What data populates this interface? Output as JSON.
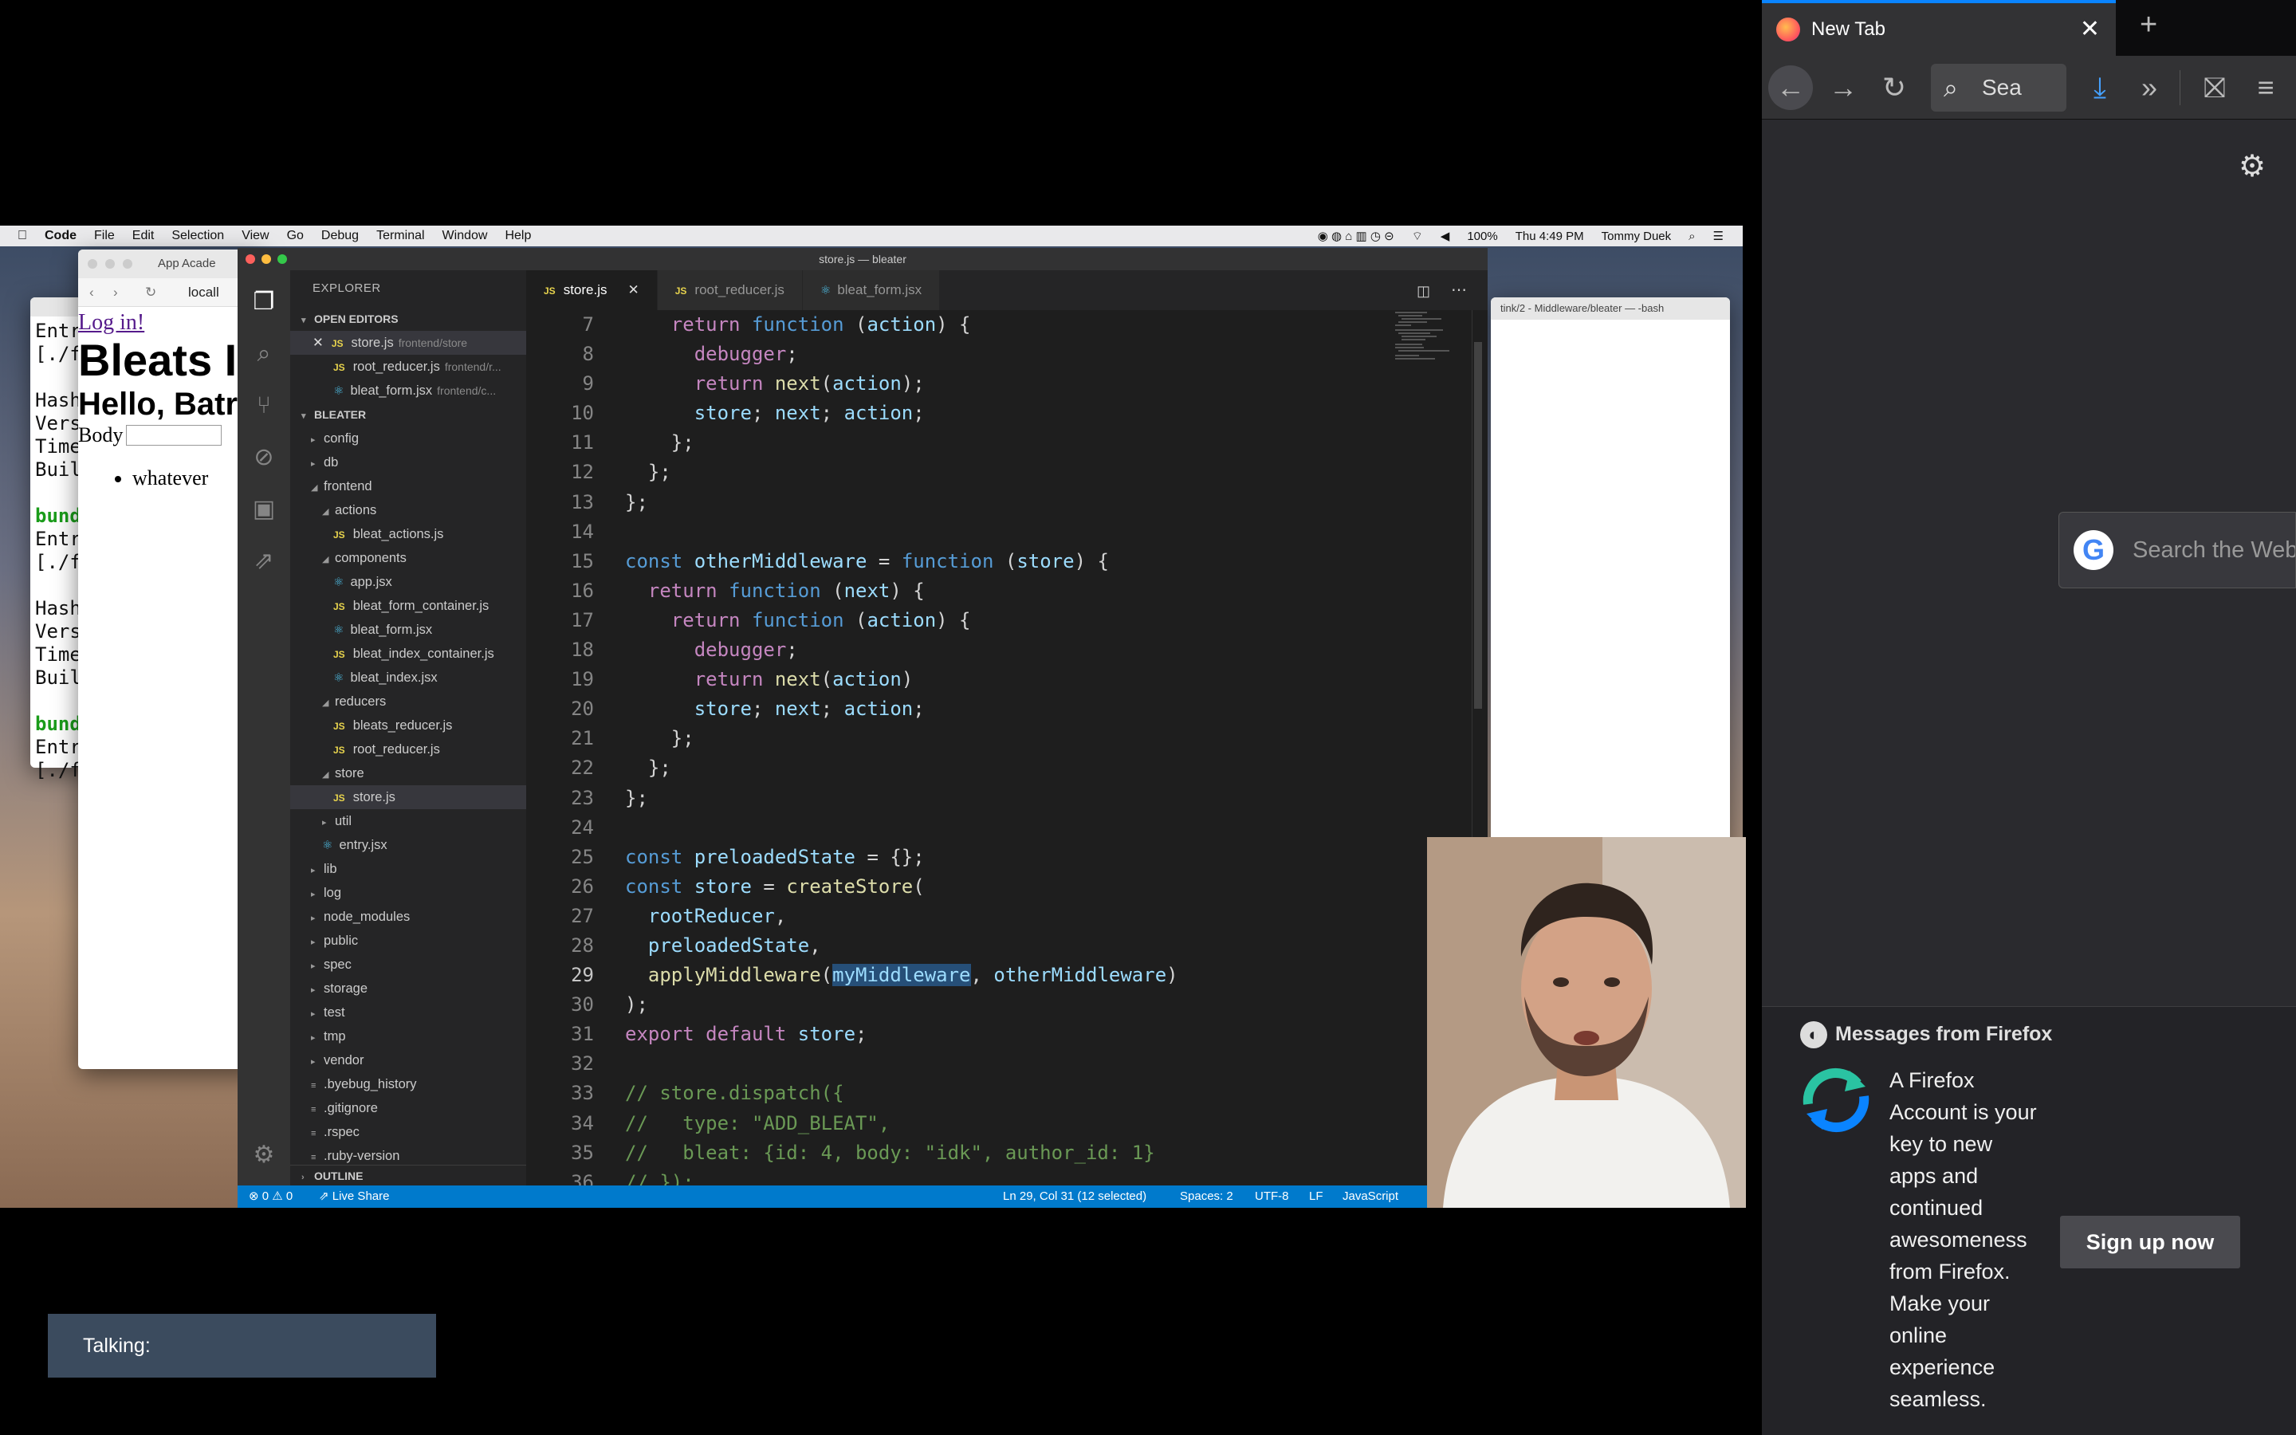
{
  "mac": {
    "menubar": {
      "app": "Code",
      "items": [
        "File",
        "Edit",
        "Selection",
        "View",
        "Go",
        "Debug",
        "Terminal",
        "Window",
        "Help"
      ],
      "battery": "100%",
      "clock": "Thu 4:49 PM",
      "user": "Tommy Duek"
    },
    "browser_window": {
      "tab": "App Acade",
      "url": "locall",
      "login_link": "Log in!",
      "heading": "Bleats I",
      "subheading": "Hello, Batr",
      "body_label": "Body",
      "list_item": "whatever"
    },
    "terminal_left": {
      "lines": [
        "Entr",
        "[./f",
        "",
        "Hash",
        "Vers",
        "Time",
        "Buil",
        "",
        "bund",
        "Entr",
        "[./f",
        "",
        "Hash",
        "Vers",
        "Time",
        "Buil",
        "",
        "bund",
        "Entr",
        "[./f"
      ]
    },
    "terminal_right_title": "tink/2 - Middleware/bleater — -bash"
  },
  "vscode": {
    "title": "store.js — bleater",
    "explorer_title": "EXPLORER",
    "open_editors_label": "OPEN EDITORS",
    "open_editors": [
      {
        "name": "store.js",
        "path": "frontend/store",
        "type": "js",
        "active": true
      },
      {
        "name": "root_reducer.js",
        "path": "frontend/r...",
        "type": "js"
      },
      {
        "name": "bleat_form.jsx",
        "path": "frontend/c...",
        "type": "jsx"
      }
    ],
    "project_label": "BLEATER",
    "tree": [
      {
        "name": "config",
        "depth": 0,
        "kind": "folder-closed"
      },
      {
        "name": "db",
        "depth": 0,
        "kind": "folder-closed"
      },
      {
        "name": "frontend",
        "depth": 0,
        "kind": "folder-open"
      },
      {
        "name": "actions",
        "depth": 1,
        "kind": "folder-open"
      },
      {
        "name": "bleat_actions.js",
        "depth": 2,
        "kind": "js"
      },
      {
        "name": "components",
        "depth": 1,
        "kind": "folder-open"
      },
      {
        "name": "app.jsx",
        "depth": 2,
        "kind": "jsx"
      },
      {
        "name": "bleat_form_container.js",
        "depth": 2,
        "kind": "js"
      },
      {
        "name": "bleat_form.jsx",
        "depth": 2,
        "kind": "jsx"
      },
      {
        "name": "bleat_index_container.js",
        "depth": 2,
        "kind": "js"
      },
      {
        "name": "bleat_index.jsx",
        "depth": 2,
        "kind": "jsx"
      },
      {
        "name": "reducers",
        "depth": 1,
        "kind": "folder-open"
      },
      {
        "name": "bleats_reducer.js",
        "depth": 2,
        "kind": "js"
      },
      {
        "name": "root_reducer.js",
        "depth": 2,
        "kind": "js"
      },
      {
        "name": "store",
        "depth": 1,
        "kind": "folder-open"
      },
      {
        "name": "store.js",
        "depth": 2,
        "kind": "js",
        "selected": true
      },
      {
        "name": "util",
        "depth": 1,
        "kind": "folder-closed"
      },
      {
        "name": "entry.jsx",
        "depth": 1,
        "kind": "jsx"
      },
      {
        "name": "lib",
        "depth": 0,
        "kind": "folder-closed"
      },
      {
        "name": "log",
        "depth": 0,
        "kind": "folder-closed"
      },
      {
        "name": "node_modules",
        "depth": 0,
        "kind": "folder-closed"
      },
      {
        "name": "public",
        "depth": 0,
        "kind": "folder-closed"
      },
      {
        "name": "spec",
        "depth": 0,
        "kind": "folder-closed"
      },
      {
        "name": "storage",
        "depth": 0,
        "kind": "folder-closed"
      },
      {
        "name": "test",
        "depth": 0,
        "kind": "folder-closed"
      },
      {
        "name": "tmp",
        "depth": 0,
        "kind": "folder-closed"
      },
      {
        "name": "vendor",
        "depth": 0,
        "kind": "folder-closed"
      },
      {
        "name": ".byebug_history",
        "depth": 0,
        "kind": "file"
      },
      {
        "name": ".gitignore",
        "depth": 0,
        "kind": "file"
      },
      {
        "name": ".rspec",
        "depth": 0,
        "kind": "file"
      },
      {
        "name": ".ruby-version",
        "depth": 0,
        "kind": "file"
      }
    ],
    "outline_label": "OUTLINE",
    "tabs": [
      {
        "name": "store.js",
        "type": "js",
        "active": true
      },
      {
        "name": "root_reducer.js",
        "type": "js"
      },
      {
        "name": "bleat_form.jsx",
        "type": "jsx"
      }
    ],
    "code": [
      {
        "n": "7",
        "t": "    return function (action) {"
      },
      {
        "n": "8",
        "t": "      debugger;"
      },
      {
        "n": "9",
        "t": "      return next(action);"
      },
      {
        "n": "10",
        "t": "      store; next; action;"
      },
      {
        "n": "11",
        "t": "    };"
      },
      {
        "n": "12",
        "t": "  };"
      },
      {
        "n": "13",
        "t": "};"
      },
      {
        "n": "14",
        "t": ""
      },
      {
        "n": "15",
        "t": "const otherMiddleware = function (store) {"
      },
      {
        "n": "16",
        "t": "  return function (next) {"
      },
      {
        "n": "17",
        "t": "    return function (action) {"
      },
      {
        "n": "18",
        "t": "      debugger;"
      },
      {
        "n": "19",
        "t": "      return next(action)"
      },
      {
        "n": "20",
        "t": "      store; next; action;"
      },
      {
        "n": "21",
        "t": "    };"
      },
      {
        "n": "22",
        "t": "  };"
      },
      {
        "n": "23",
        "t": "};"
      },
      {
        "n": "24",
        "t": ""
      },
      {
        "n": "25",
        "t": "const preloadedState = {};"
      },
      {
        "n": "26",
        "t": "const store = createStore("
      },
      {
        "n": "27",
        "t": "  rootReducer,"
      },
      {
        "n": "28",
        "t": "  preloadedState,"
      },
      {
        "n": "29",
        "t": "  applyMiddleware(myMiddleware, otherMiddleware)"
      },
      {
        "n": "30",
        "t": ");"
      },
      {
        "n": "31",
        "t": "export default store;"
      },
      {
        "n": "32",
        "t": ""
      },
      {
        "n": "33",
        "t": "// store.dispatch({"
      },
      {
        "n": "34",
        "t": "//   type: \"ADD_BLEAT\","
      },
      {
        "n": "35",
        "t": "//   bleat: {id: 4, body: \"idk\", author_id: 1}"
      },
      {
        "n": "36",
        "t": "// });"
      }
    ],
    "status": {
      "errors": "0",
      "warnings": "0",
      "live_share": "Live Share",
      "position": "Ln 29, Col 31 (12 selected)",
      "spaces": "Spaces: 2",
      "encoding": "UTF-8",
      "eol": "LF",
      "language": "JavaScript"
    }
  },
  "firefox": {
    "tab_title": "New Tab",
    "search_placeholder": "Sea",
    "google_search_placeholder": "Search the Web",
    "messages_title": "Messages from Firefox",
    "message_body": "A Firefox Account is your key to new apps and continued awesomeness from Firefox. Make your online experience seamless.",
    "signup_label": "Sign up now"
  },
  "overlay": {
    "talking_label": "Talking:"
  },
  "colors": {
    "accent": "#007acc",
    "firefox_blue": "#0a84ff",
    "editor_bg": "#1e1e1e"
  }
}
